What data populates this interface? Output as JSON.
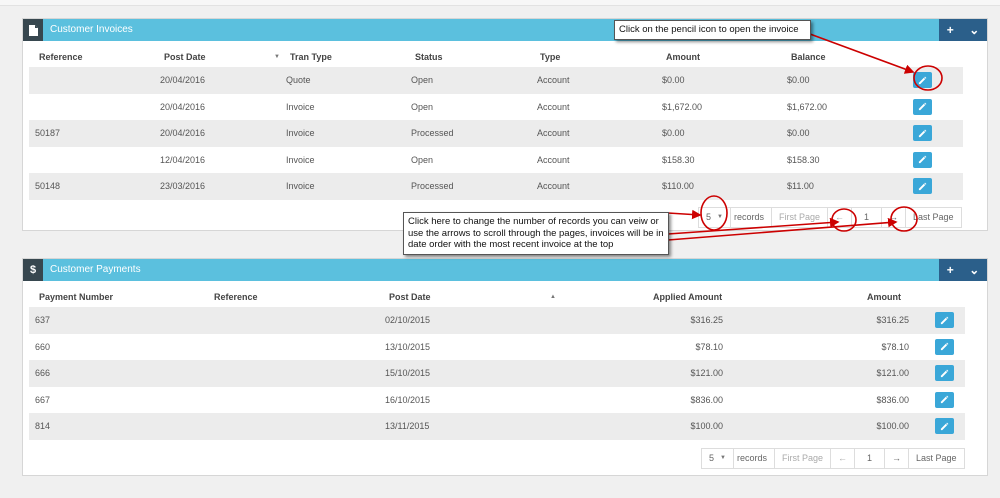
{
  "invoices": {
    "title": "Customer Invoices",
    "columns": [
      "Reference",
      "Post Date",
      "Tran Type",
      "Status",
      "Type",
      "Amount",
      "Balance"
    ],
    "rows": [
      [
        "",
        "20/04/2016",
        "Quote",
        "Open",
        "Account",
        "$0.00",
        "$0.00"
      ],
      [
        "",
        "20/04/2016",
        "Invoice",
        "Open",
        "Account",
        "$1,672.00",
        "$1,672.00"
      ],
      [
        "50187",
        "20/04/2016",
        "Invoice",
        "Processed",
        "Account",
        "$0.00",
        "$0.00"
      ],
      [
        "",
        "12/04/2016",
        "Invoice",
        "Open",
        "Account",
        "$158.30",
        "$158.30"
      ],
      [
        "50148",
        "23/03/2016",
        "Invoice",
        "Processed",
        "Account",
        "$110.00",
        "$11.00"
      ]
    ],
    "pager": {
      "page_size": "5",
      "records": "records",
      "first": "First Page",
      "prev": "←",
      "page": "1",
      "next": "→",
      "last": "Last Page"
    }
  },
  "payments": {
    "title": "Customer Payments",
    "columns": [
      "Payment Number",
      "Reference",
      "Post Date",
      "Applied Amount",
      "Amount"
    ],
    "rows": [
      [
        "637",
        "",
        "02/10/2015",
        "$316.25",
        "$316.25"
      ],
      [
        "660",
        "",
        "13/10/2015",
        "$78.10",
        "$78.10"
      ],
      [
        "666",
        "",
        "15/10/2015",
        "$121.00",
        "$121.00"
      ],
      [
        "667",
        "",
        "16/10/2015",
        "$836.00",
        "$836.00"
      ],
      [
        "814",
        "",
        "13/11/2015",
        "$100.00",
        "$100.00"
      ]
    ],
    "pager": {
      "page_size": "5",
      "records": "records",
      "first": "First Page",
      "prev": "←",
      "page": "1",
      "next": "→",
      "last": "Last Page"
    }
  },
  "header_buttons": {
    "add": "+",
    "collapse": "⌄"
  },
  "icons": {
    "invoices_header": "document-icon",
    "payments_header": "dollar-icon",
    "edit": "pencil-icon",
    "sort_down": "▼",
    "sort_up": "▲"
  },
  "header_icon_glyphs": {
    "payments": "$"
  },
  "annotations": {
    "pencil_callout": "Click on the pencil icon to open the invoice",
    "pager_callout": "Click here to change the number of records you can veiw or use the arrows to scroll through the pages, invoices will be in date order with the most recent invoice at the top"
  },
  "colors": {
    "header": "#5bc0de",
    "header_icon": "#37474f",
    "header_buttons": "#2b5f8a",
    "edit_button": "#3aa7d8",
    "annotation": "#cc0000"
  }
}
